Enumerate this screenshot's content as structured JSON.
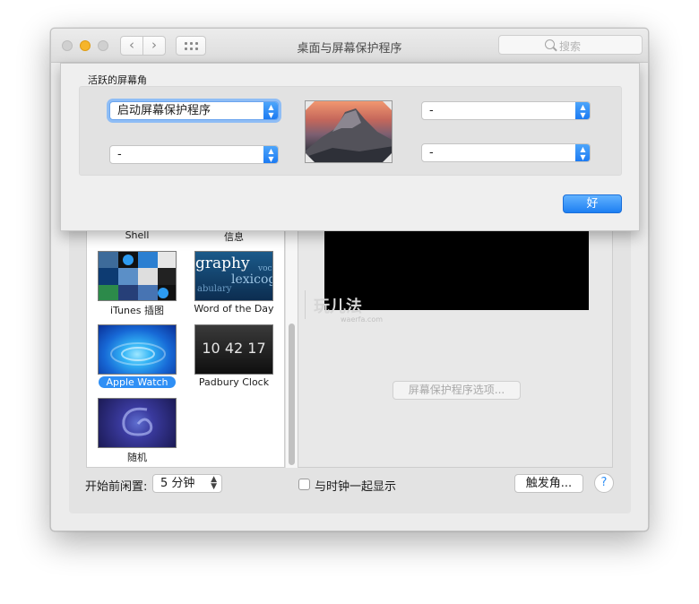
{
  "window": {
    "title": "桌面与屏幕保护程序",
    "search_placeholder": "搜索"
  },
  "sheet": {
    "group_title": "活跃的屏幕角",
    "corners": {
      "top_left": "启动屏幕保护程序",
      "top_right": "-",
      "bottom_left": "-",
      "bottom_right": "-"
    },
    "ok_label": "好"
  },
  "screensavers": {
    "partial_labels": [
      "Shell",
      "信息"
    ],
    "items": [
      {
        "label": "iTunes 插图",
        "selected": false
      },
      {
        "label": "Word of the Day",
        "selected": false
      },
      {
        "label": "Apple Watch",
        "selected": true
      },
      {
        "label": "Padbury Clock",
        "selected": false
      },
      {
        "label": "随机",
        "selected": false
      }
    ],
    "word_of_day_words": [
      "graphy",
      "lexicog",
      "abulary",
      "voc"
    ],
    "clock_time": "10 42 17"
  },
  "preview": {
    "options_label": "屏幕保护程序选项..."
  },
  "footer": {
    "idle_label": "开始前闲置:",
    "idle_value": "5 分钟",
    "show_clock_label": "与时钟一起显示",
    "hot_corners_label": "触发角...",
    "help_label": "?"
  },
  "watermark": {
    "text": "玩儿法",
    "url": "waerfa.com"
  },
  "colors": {
    "accent": "#2f8ff5",
    "minimize": "#f6b52b"
  }
}
